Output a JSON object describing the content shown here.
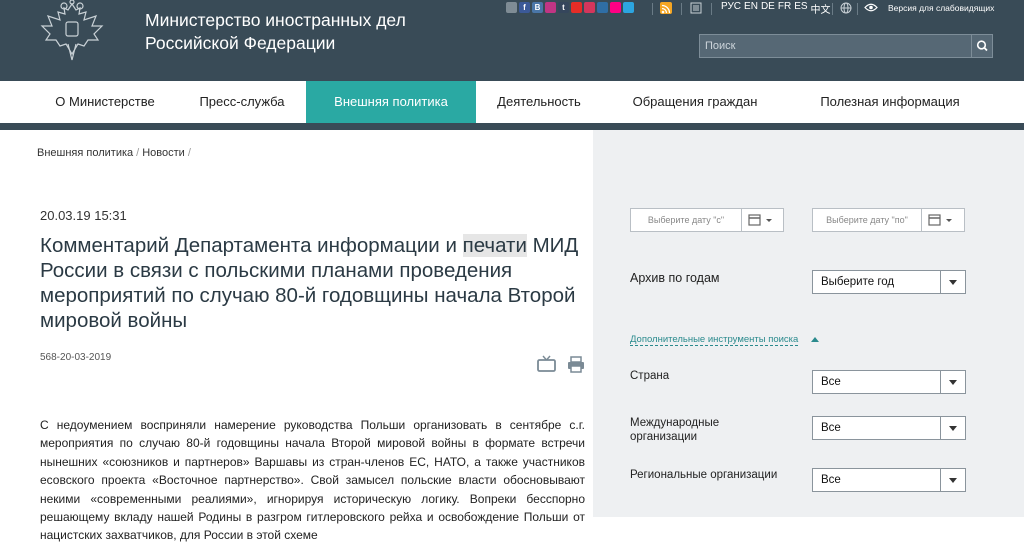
{
  "header": {
    "title_line1": "Министерство иностранных дел",
    "title_line2": "Российской Федерации",
    "social_icons": [
      {
        "name": "share-icon",
        "color": "#7f8c95",
        "glyph": ""
      },
      {
        "name": "facebook-icon",
        "color": "#3b5998",
        "glyph": "f"
      },
      {
        "name": "vk-icon",
        "color": "#4a76a8",
        "glyph": "B"
      },
      {
        "name": "instagram-icon",
        "color": "#c13584",
        "glyph": ""
      },
      {
        "name": "tumblr-icon",
        "color": "#35465c",
        "glyph": "t"
      },
      {
        "name": "youtube-icon",
        "color": "#e52d27",
        "glyph": ""
      },
      {
        "name": "periscope-icon",
        "color": "#d4365c",
        "glyph": ""
      },
      {
        "name": "livejournal-icon",
        "color": "#2f6ea5",
        "glyph": ""
      },
      {
        "name": "flickr-icon",
        "color": "#ff0084",
        "glyph": ""
      },
      {
        "name": "telegram-icon",
        "color": "#2ca5e0",
        "glyph": ""
      }
    ],
    "languages": [
      "РУС",
      "EN",
      "DE",
      "FR",
      "ES",
      "中文"
    ],
    "low_vision_label": "Версия для слабовидящих",
    "search_placeholder": "Поиск"
  },
  "nav": {
    "items": [
      {
        "label": "О Министерстве",
        "active": false
      },
      {
        "label": "Пресс-служба",
        "active": false
      },
      {
        "label": "Внешняя политика",
        "active": true
      },
      {
        "label": "Деятельность",
        "active": false
      },
      {
        "label": "Обращения граждан",
        "active": false
      },
      {
        "label": "Полезная информация",
        "active": false
      }
    ]
  },
  "breadcrumb": [
    "Внешняя политика",
    "Новости"
  ],
  "article": {
    "datetime": "20.03.19 15:31",
    "title_before": "Комментарий Департамента информации и ",
    "title_highlight": "печати",
    "title_after": " МИД России в связи с польскими планами проведения мероприятий по случаю 80-й годовщины начала Второй мировой войны",
    "doc_number": "568-20-03-2019",
    "body": "С недоумением восприняли намерение руководства Польши организовать в сентябре с.г. мероприятия по случаю 80-й годовщины начала Второй мировой войны в формате встречи нынешних «союзников и партнеров» Варшавы из стран-членов ЕС, НАТО, а также участников есовского проекта «Восточное партнерство». Свой замысел польские власти обосновывают некими «современными реалиями», игнорируя историческую логику. Вопреки бесспорно решающему вкладу нашей Родины в разгром гитлеровского рейха и освобождение Польши от нацистских захватчиков, для России в этой схеме"
  },
  "sidebar": {
    "date_from_placeholder": "Выберите дату \"с\"",
    "date_to_placeholder": "Выберите дату \"по\"",
    "archive_label": "Архив по годам",
    "archive_value": "Выберите год",
    "more_tools_label": "Дополнительные инструменты поиска",
    "country_label": "Страна",
    "country_value": "Все",
    "intl_orgs_label_1": "Международные",
    "intl_orgs_label_2": "организации",
    "intl_orgs_value": "Все",
    "regional_orgs_label": "Региональные организации",
    "regional_orgs_value": "Все"
  },
  "colors": {
    "header_bg": "#394b57",
    "nav_active": "#2aa9a3",
    "link_teal": "#2a8a8d",
    "sidebar_bg": "#eef0f2"
  }
}
